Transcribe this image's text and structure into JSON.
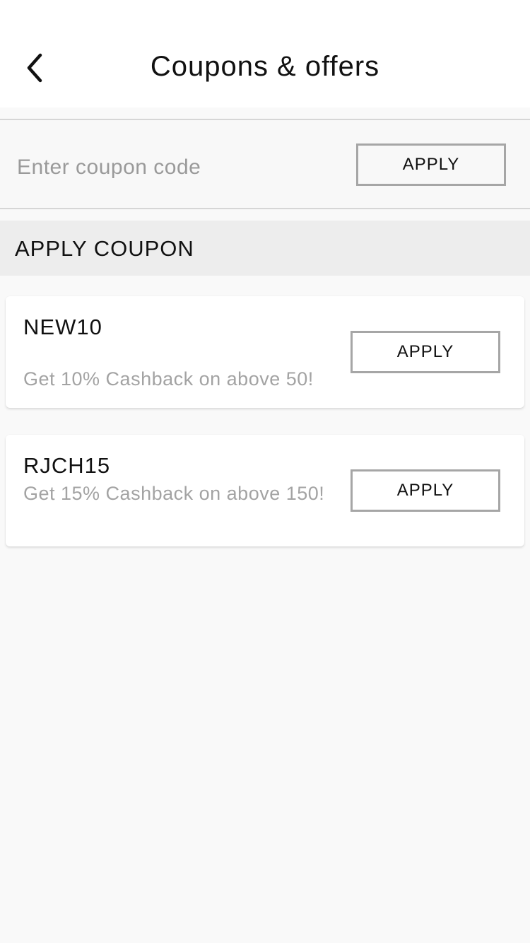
{
  "header": {
    "title": "Coupons & offers",
    "back_icon": "chevron-left-icon"
  },
  "coupon_entry": {
    "placeholder": "Enter coupon code",
    "value": "",
    "apply_label": "APPLY"
  },
  "section": {
    "title": "APPLY COUPON"
  },
  "coupons": [
    {
      "code": "NEW10",
      "description": "Get 10% Cashback on above 50!",
      "apply_label": "APPLY"
    },
    {
      "code": "RJCH15",
      "description": "Get 15% Cashback on above 150!",
      "apply_label": "APPLY"
    }
  ],
  "colors": {
    "background": "#f9f9f9",
    "header_bg": "#ffffff",
    "section_bg": "#ededed",
    "button_border": "#a6a6a6",
    "muted_text": "#a3a3a3"
  }
}
